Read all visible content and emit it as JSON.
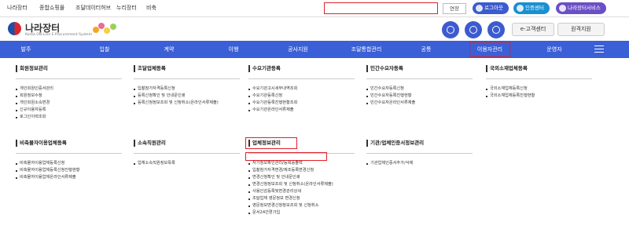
{
  "topbar": {
    "links": [
      "나라장터",
      "종합쇼핑몰",
      "조달데이터허브",
      "누리장터",
      "비축"
    ],
    "ext_button": "연장",
    "buttons": [
      {
        "label": "로그아웃",
        "color": "#3c5bd0"
      },
      {
        "label": "인증센터",
        "color": "#1a8fd1"
      },
      {
        "label": "나라장터서비스",
        "color": "#6b4fc6"
      }
    ]
  },
  "header": {
    "logo_title": "나라장터",
    "logo_sub": "Korea ON-Line E-Procurement System",
    "customer_center": "e-고객센터",
    "remote_support": "원격지원"
  },
  "nav": {
    "items": [
      "발주",
      "입찰",
      "계약",
      "이행",
      "공사지원",
      "조달통합관리",
      "공통",
      "이용자관리",
      "운영자"
    ],
    "highlight_index": 7
  },
  "sections": [
    {
      "title": "회원정보관리",
      "items": [
        "개인회원인증서관리",
        "회원정보수정",
        "개인회원소속변경",
        "신규이용자등록",
        "로그인이력조회"
      ]
    },
    {
      "title": "조달업체등록",
      "items": [
        "입찰참가자격등록신청",
        "등록신청확인 및 안내문인쇄",
        "등록신청정보조회 및 신청취소(온라인서류제출)"
      ]
    },
    {
      "title": "수요기관등록",
      "items": [
        "수요기관고시세부내역조회",
        "수요기관등록신청",
        "수요기관등록진행현황조회",
        "수요기관온라인서류제출"
      ]
    },
    {
      "title": "민간수요자등록",
      "items": [
        "민간수요자등록신청",
        "민간수요자등록진행현황",
        "민간수요자온라인서류제출"
      ]
    },
    {
      "title": "국외소재업체등록",
      "items": [
        "국외소재업체등록신청",
        "국외소재업체등록진행현황"
      ]
    },
    {
      "title": "비축물자이용업체등록",
      "items": [
        "비축물자이용업체등록신청",
        "비축물자이용업체등록신청진행현황",
        "비축물자이용업체온라인서류제출"
      ]
    },
    {
      "title": "소속직원관리",
      "items": [
        "업체소속직원정보목록"
      ]
    },
    {
      "title": "업체정보관리",
      "items": [
        "자기정보확인관리/등록증출력",
        "입찰참가자격변경/제조등록변경신청",
        "변경신청확인 및 안내문인쇄",
        "변경신청정보조회 및 신청취소(온라인서류제출)",
        "사용인감등록및변경관리상세",
        "조달업체 영문정보 변경신청",
        "영문정보변경신청정보조회 및 신청취소",
        "문서24간편가입"
      ]
    },
    {
      "title": "기관/업체인증서정보관리",
      "items": [
        "기관업체인증서추가/삭제"
      ]
    }
  ],
  "colors": {
    "nav_bg": "#3b5fd6",
    "highlight": "#e0202a"
  }
}
